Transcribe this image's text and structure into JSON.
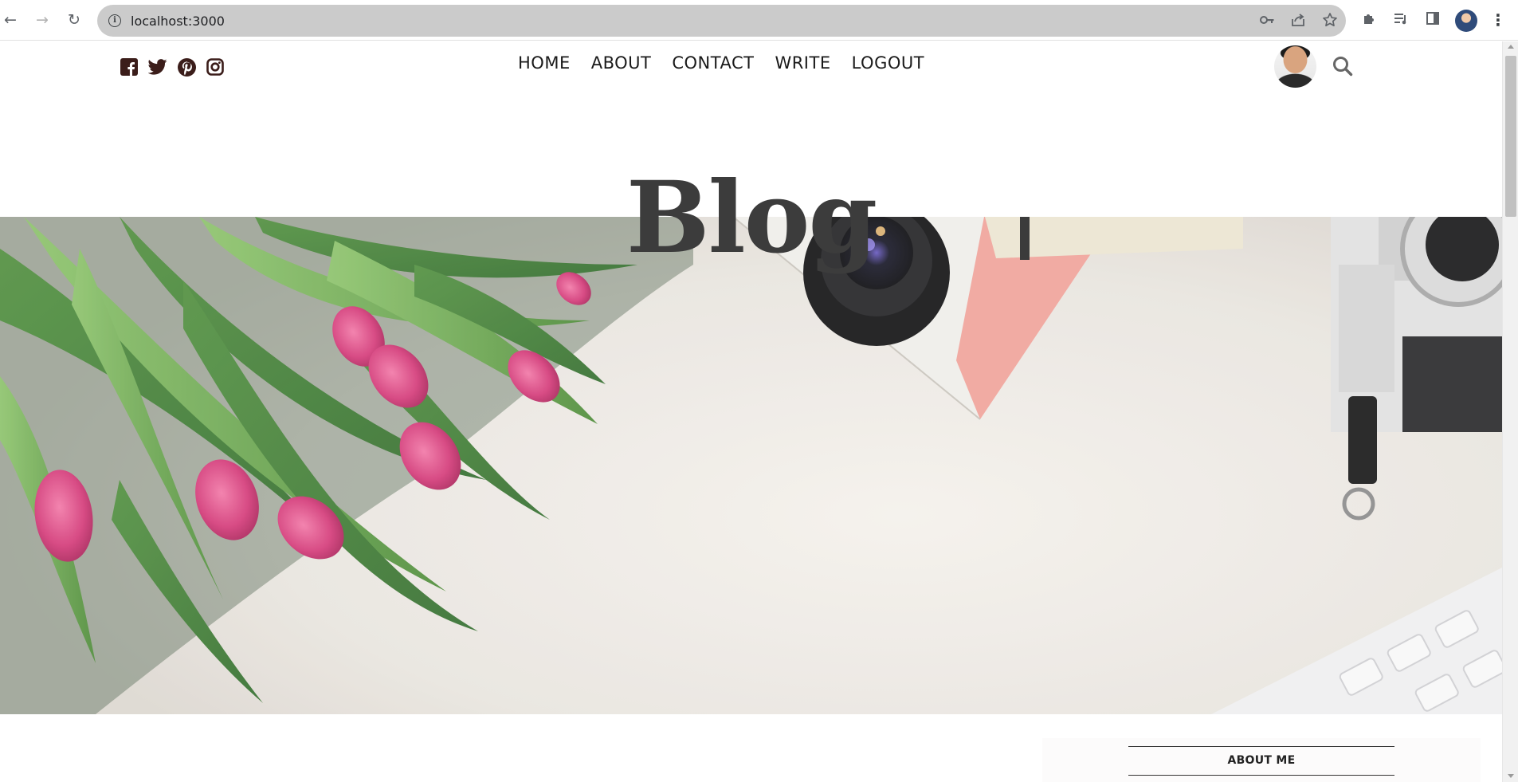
{
  "browser": {
    "url": "localhost:3000",
    "back_icon": "arrow-left-icon",
    "forward_icon": "arrow-right-icon",
    "reload_icon": "reload-icon",
    "omnibox_icons": [
      "info-icon",
      "key-icon",
      "share-icon",
      "star-icon"
    ],
    "toolbar_icons": [
      "puzzle-icon",
      "media-icon",
      "sidepanel-icon",
      "profile-avatar",
      "more-vert-icon"
    ]
  },
  "header": {
    "social_icons": [
      "facebook-square-icon",
      "twitter-icon",
      "pinterest-icon",
      "instagram-icon"
    ],
    "nav": [
      {
        "label": "HOME"
      },
      {
        "label": "ABOUT"
      },
      {
        "label": "CONTACT"
      },
      {
        "label": "WRITE"
      },
      {
        "label": "LOGOUT"
      }
    ],
    "search_icon": "search-icon",
    "accent_color": "#3b1d1a"
  },
  "hero": {
    "title": "Blog",
    "title_color": "#3c3c3c"
  },
  "sidebar": {
    "title": "ABOUT ME"
  }
}
